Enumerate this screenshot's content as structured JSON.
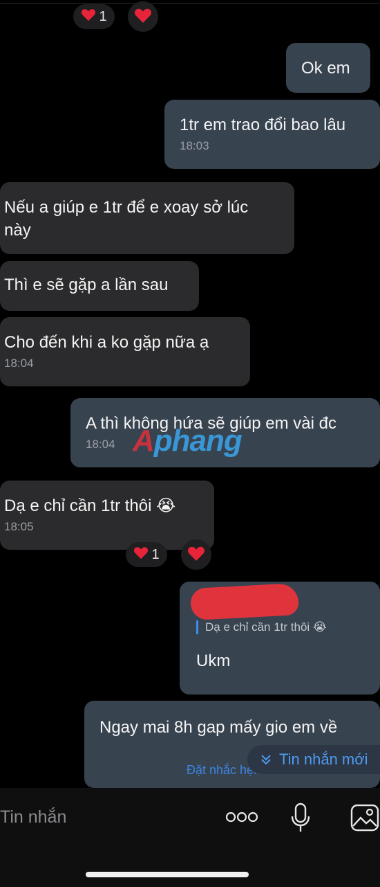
{
  "reactions_top": {
    "count": "1"
  },
  "messages": [
    {
      "text": "Ok em",
      "time": ""
    },
    {
      "text": "1tr em trao đổi bao lâu",
      "time": "18:03"
    },
    {
      "text": "Nếu a giúp e 1tr để e xoay sở lúc\nnày",
      "time": ""
    },
    {
      "text": "Thì e sẽ gặp a lần sau",
      "time": ""
    },
    {
      "text": "Cho đến khi a ko gặp nữa ạ",
      "time": "18:04"
    },
    {
      "text": "A thì không hứa sẽ giúp em vài đc",
      "time": "18:04"
    },
    {
      "text": "Dạ e chỉ cần 1tr thôi 😭",
      "time": "18:05"
    },
    {
      "reply_to": "Dạ e chỉ cần 1tr thôi 😭",
      "text": "Ukm",
      "time": ""
    },
    {
      "text": "Ngay mai 8h gap mấy gio em về",
      "time": ""
    }
  ],
  "reactions_mid": {
    "count": "1"
  },
  "watermark": {
    "a": "A",
    "rest": "phang"
  },
  "new_messages_label": "Tin nhắn mới",
  "remind_label": "Đặt nhắc hẹn",
  "composer": {
    "placeholder": "Tin nhắn"
  },
  "icons": [
    "heart-icon",
    "more-icon",
    "microphone-icon",
    "image-icon",
    "chevron-down-icon"
  ],
  "colors": {
    "incoming_bubble": "#2b2b2d",
    "outgoing_bubble": "#384350",
    "accent": "#3c8df0",
    "heart": "#e8243a"
  }
}
